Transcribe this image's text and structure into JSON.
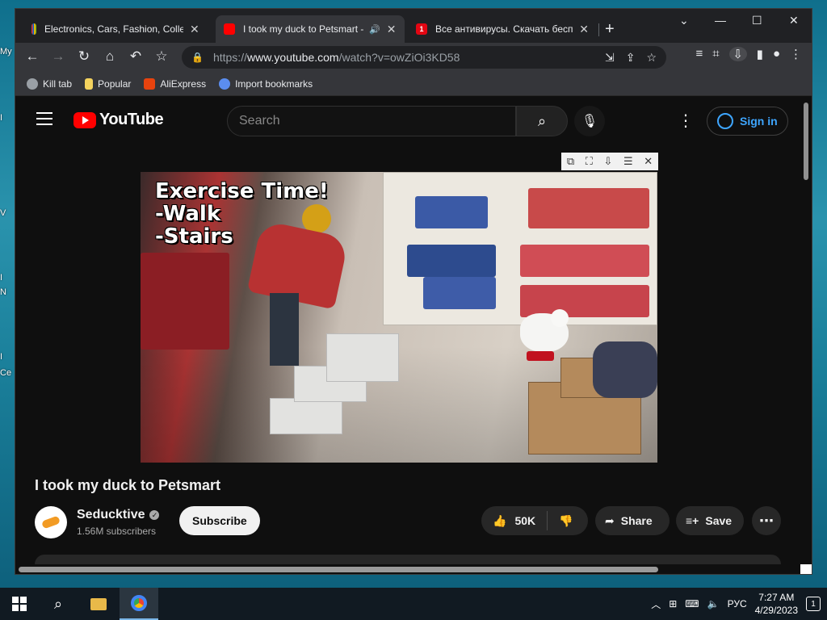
{
  "desktop": {
    "labels": [
      "My",
      "I",
      "V",
      "I",
      "N",
      "I",
      "Ce"
    ]
  },
  "browser": {
    "tabs": [
      {
        "title": "Electronics, Cars, Fashion, Collect",
        "favicon_color": "#e53238",
        "active": false
      },
      {
        "title": "I took my duck to Petsmart - ",
        "favicon_color": "#ff0000",
        "active": true,
        "audio": "🔊"
      },
      {
        "title": "Все антивирусы. Скачать беспл",
        "favicon_color": "#e30613",
        "favicon_text": "1",
        "active": false
      }
    ],
    "new_tab": "+",
    "window_controls": {
      "chevron": "⌄",
      "minimize": "—",
      "maximize": "☐",
      "close": "✕"
    },
    "url": {
      "scheme": "https://",
      "host": "www.youtube.com",
      "path": "/watch?v=owZiOi3KD58"
    },
    "bookmarks": [
      {
        "label": "Kill tab",
        "icon": "globe-icon",
        "color": "#9aa0a6"
      },
      {
        "label": "Popular",
        "icon": "folder-icon",
        "color": "#f4d35e"
      },
      {
        "label": "AliExpress",
        "icon": "aliexpress-icon",
        "color": "#e8430e"
      },
      {
        "label": "Import bookmarks",
        "icon": "gear-icon",
        "color": "#5b8def"
      }
    ]
  },
  "youtube": {
    "logo_text": "YouTube",
    "search_placeholder": "Search",
    "sign_in": "Sign in",
    "video": {
      "caption_lines": [
        "Exercise Time!",
        "-Walk",
        "-Stairs"
      ],
      "title": "I took my duck to Petsmart"
    },
    "channel": {
      "name": "Seducktive",
      "verified": "✓",
      "subscribers": "1.56M subscribers"
    },
    "actions": {
      "subscribe": "Subscribe",
      "likes": "50K",
      "share": "Share",
      "save": "Save",
      "more": "⋯"
    },
    "pip_controls": [
      "⧉",
      "⛶",
      "⇩",
      "☰",
      "✕"
    ]
  },
  "taskbar": {
    "language": "РУС",
    "time": "7:27 AM",
    "date": "4/29/2023",
    "notifications": "1"
  },
  "colors": {
    "accent_blue": "#3ea6ff",
    "youtube_red": "#ff0000",
    "page_bg": "#0f0f0f"
  }
}
